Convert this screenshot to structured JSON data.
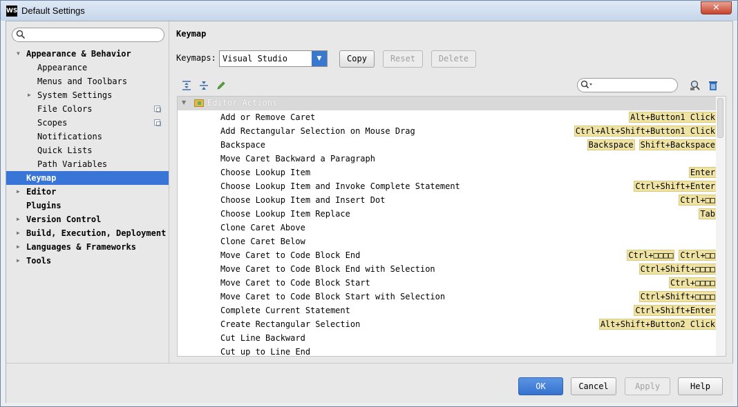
{
  "window": {
    "title": "Default Settings",
    "app_icon": "WS",
    "close": "✕"
  },
  "sidebar": {
    "search": {
      "value": "",
      "placeholder": ""
    },
    "items": [
      {
        "label": "Appearance & Behavior",
        "level": 0,
        "expanded": true,
        "has_arrow": true,
        "bold": true
      },
      {
        "label": "Appearance",
        "level": 1
      },
      {
        "label": "Menus and Toolbars",
        "level": 1
      },
      {
        "label": "System Settings",
        "level": 1,
        "has_arrow": true
      },
      {
        "label": "File Colors",
        "level": 1,
        "copy_icon": true
      },
      {
        "label": "Scopes",
        "level": 1,
        "copy_icon": true
      },
      {
        "label": "Notifications",
        "level": 1
      },
      {
        "label": "Quick Lists",
        "level": 1
      },
      {
        "label": "Path Variables",
        "level": 1
      },
      {
        "label": "Keymap",
        "level": 0,
        "selected": true,
        "bold": true
      },
      {
        "label": "Editor",
        "level": 0,
        "has_arrow": true,
        "bold": true
      },
      {
        "label": "Plugins",
        "level": 0,
        "bold": true
      },
      {
        "label": "Version Control",
        "level": 0,
        "has_arrow": true,
        "bold": true
      },
      {
        "label": "Build, Execution, Deployment",
        "level": 0,
        "has_arrow": true,
        "bold": true
      },
      {
        "label": "Languages & Frameworks",
        "level": 0,
        "has_arrow": true,
        "bold": true
      },
      {
        "label": "Tools",
        "level": 0,
        "has_arrow": true,
        "bold": true
      }
    ]
  },
  "keymap": {
    "heading": "Keymap",
    "keymaps_label": "Keymaps:",
    "selected_keymap": "Visual Studio",
    "copy_label": "Copy",
    "reset_label": "Reset",
    "delete_label": "Delete",
    "filter": {
      "value": "",
      "placeholder": ""
    },
    "group_label": "Editor Actions",
    "actions": [
      {
        "name": "Add or Remove Caret",
        "shortcuts": [
          "Alt+Button1 Click"
        ]
      },
      {
        "name": "Add Rectangular Selection on Mouse Drag",
        "shortcuts": [
          "Ctrl+Alt+Shift+Button1 Click"
        ]
      },
      {
        "name": "Backspace",
        "shortcuts": [
          "Backspace",
          "Shift+Backspace"
        ]
      },
      {
        "name": "Move Caret Backward a Paragraph",
        "shortcuts": []
      },
      {
        "name": "Choose Lookup Item",
        "shortcuts": [
          "Enter"
        ]
      },
      {
        "name": "Choose Lookup Item and Invoke Complete Statement",
        "shortcuts": [
          "Ctrl+Shift+Enter"
        ]
      },
      {
        "name": "Choose Lookup Item and Insert Dot",
        "shortcuts": [
          "Ctrl+□□"
        ]
      },
      {
        "name": "Choose Lookup Item Replace",
        "shortcuts": [
          "Tab"
        ]
      },
      {
        "name": "Clone Caret Above",
        "shortcuts": []
      },
      {
        "name": "Clone Caret Below",
        "shortcuts": []
      },
      {
        "name": "Move Caret to Code Block End",
        "shortcuts": [
          "Ctrl+□□□□",
          "Ctrl+□□"
        ]
      },
      {
        "name": "Move Caret to Code Block End with Selection",
        "shortcuts": [
          "Ctrl+Shift+□□□□"
        ]
      },
      {
        "name": "Move Caret to Code Block Start",
        "shortcuts": [
          "Ctrl+□□□□"
        ]
      },
      {
        "name": "Move Caret to Code Block Start with Selection",
        "shortcuts": [
          "Ctrl+Shift+□□□□"
        ]
      },
      {
        "name": "Complete Current Statement",
        "shortcuts": [
          "Ctrl+Shift+Enter"
        ]
      },
      {
        "name": "Create Rectangular Selection",
        "shortcuts": [
          "Alt+Shift+Button2 Click"
        ]
      },
      {
        "name": "Cut Line Backward",
        "shortcuts": []
      },
      {
        "name": "Cut up to Line End",
        "shortcuts": []
      }
    ]
  },
  "footer": {
    "ok_label": "OK",
    "cancel_label": "Cancel",
    "apply_label": "Apply",
    "help_label": "Help"
  },
  "colors": {
    "selection": "#3875d7",
    "shortcut_bg": "#efe3a3",
    "primary_button": "#3a78d0"
  }
}
